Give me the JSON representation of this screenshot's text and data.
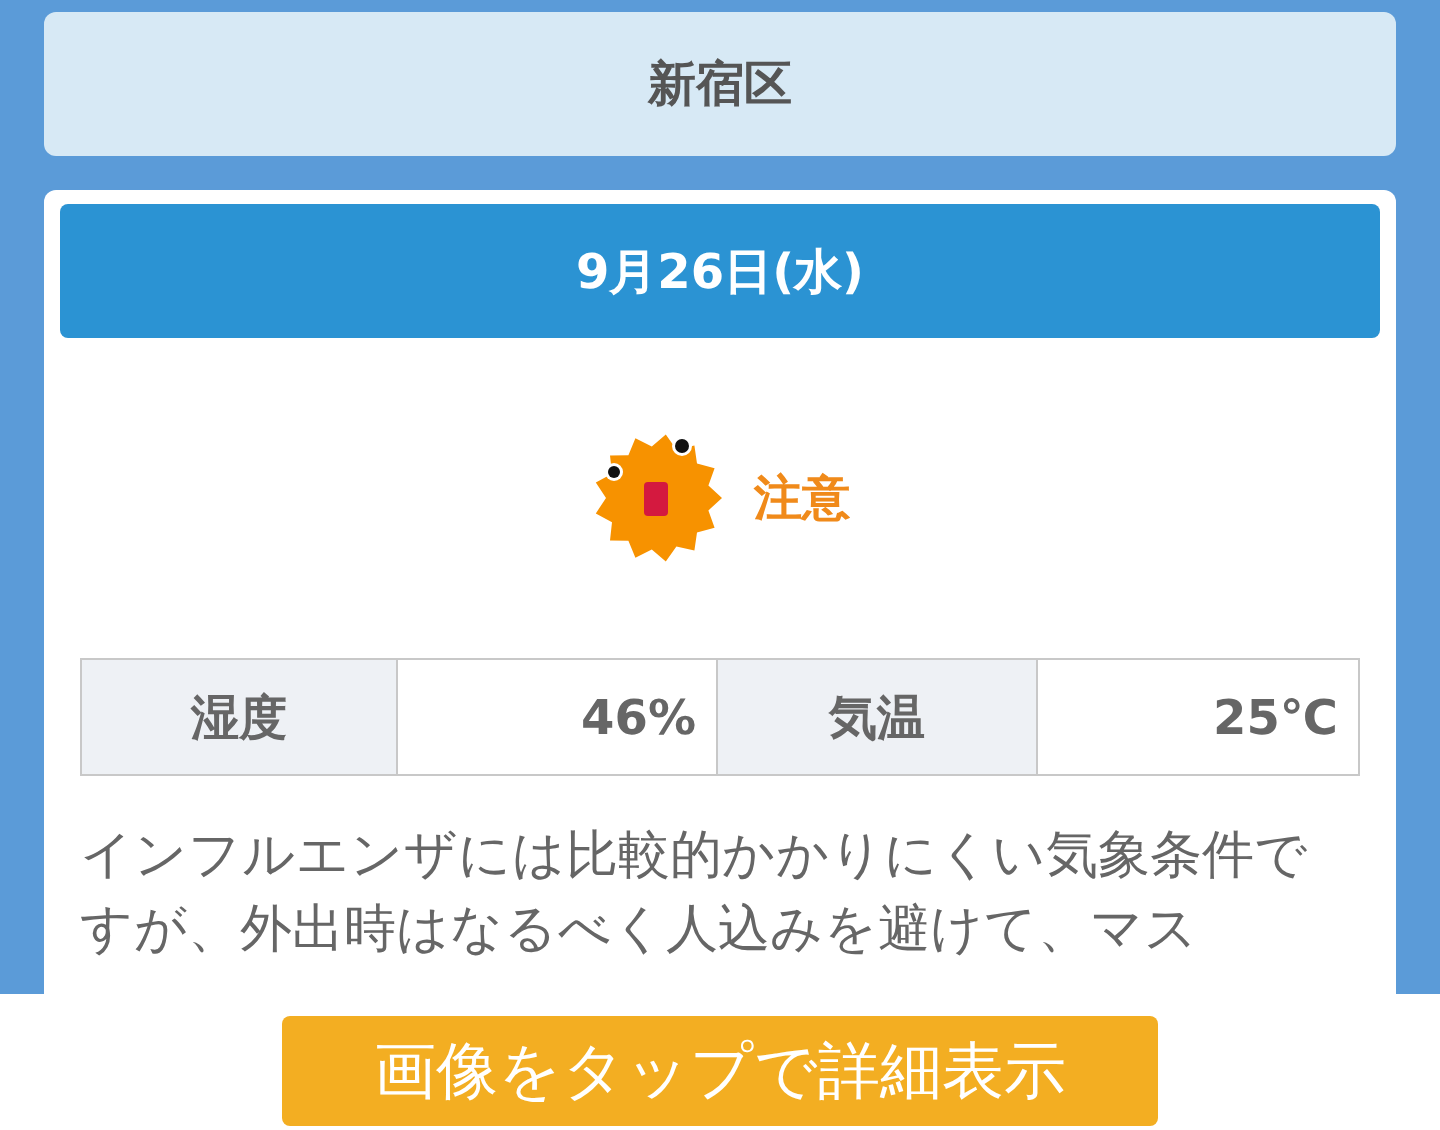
{
  "area": {
    "name": "新宿区"
  },
  "forecast": {
    "date": "9月26日(水)",
    "alert": "注意",
    "stats": [
      {
        "label": "湿度",
        "value": "46%"
      },
      {
        "label": "気温",
        "value": "25℃"
      }
    ],
    "message": "インフルエンザには比較的かかりにくい気象条件ですが、外出時はなるべく人込みを避けて、マス"
  },
  "button": "画像をタップで詳細表示"
}
